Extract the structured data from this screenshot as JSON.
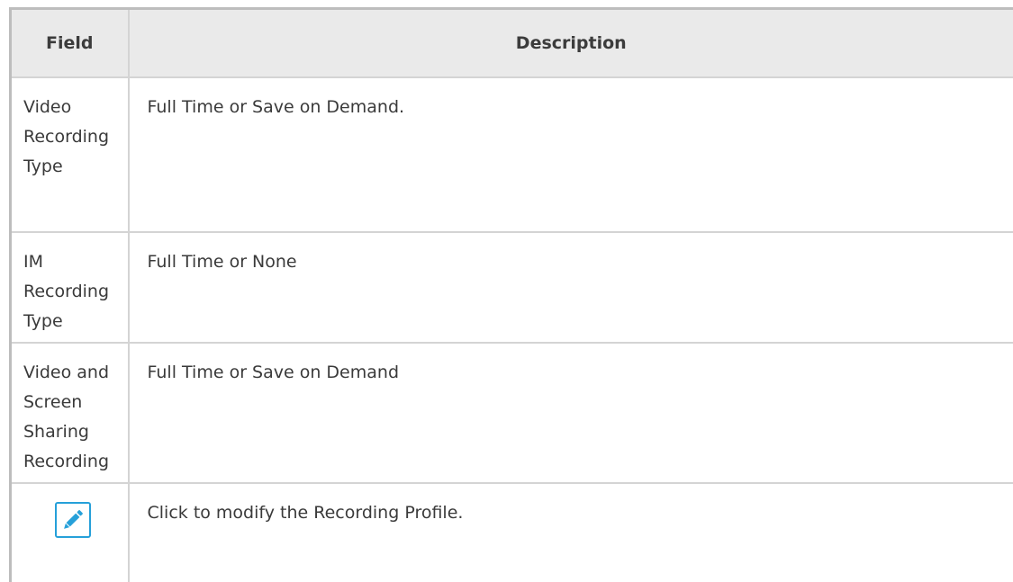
{
  "table": {
    "headers": {
      "field": "Field",
      "description": "Description"
    },
    "rows": [
      {
        "field": "Video Recording Type",
        "description": "Full Time or Save on Demand."
      },
      {
        "field": "IM Recording Type",
        "description": "Full Time or None"
      },
      {
        "field": "Video and Screen Sharing Recording",
        "description": "Full Time or Save on Demand"
      },
      {
        "field_icon": "pencil-edit-icon",
        "description": "Click to modify the Recording Profile."
      }
    ]
  },
  "colors": {
    "header_bg": "#eaeaea",
    "border": "#d4d4d4",
    "icon_accent": "#26a0d9",
    "text": "#3a3a3a"
  }
}
